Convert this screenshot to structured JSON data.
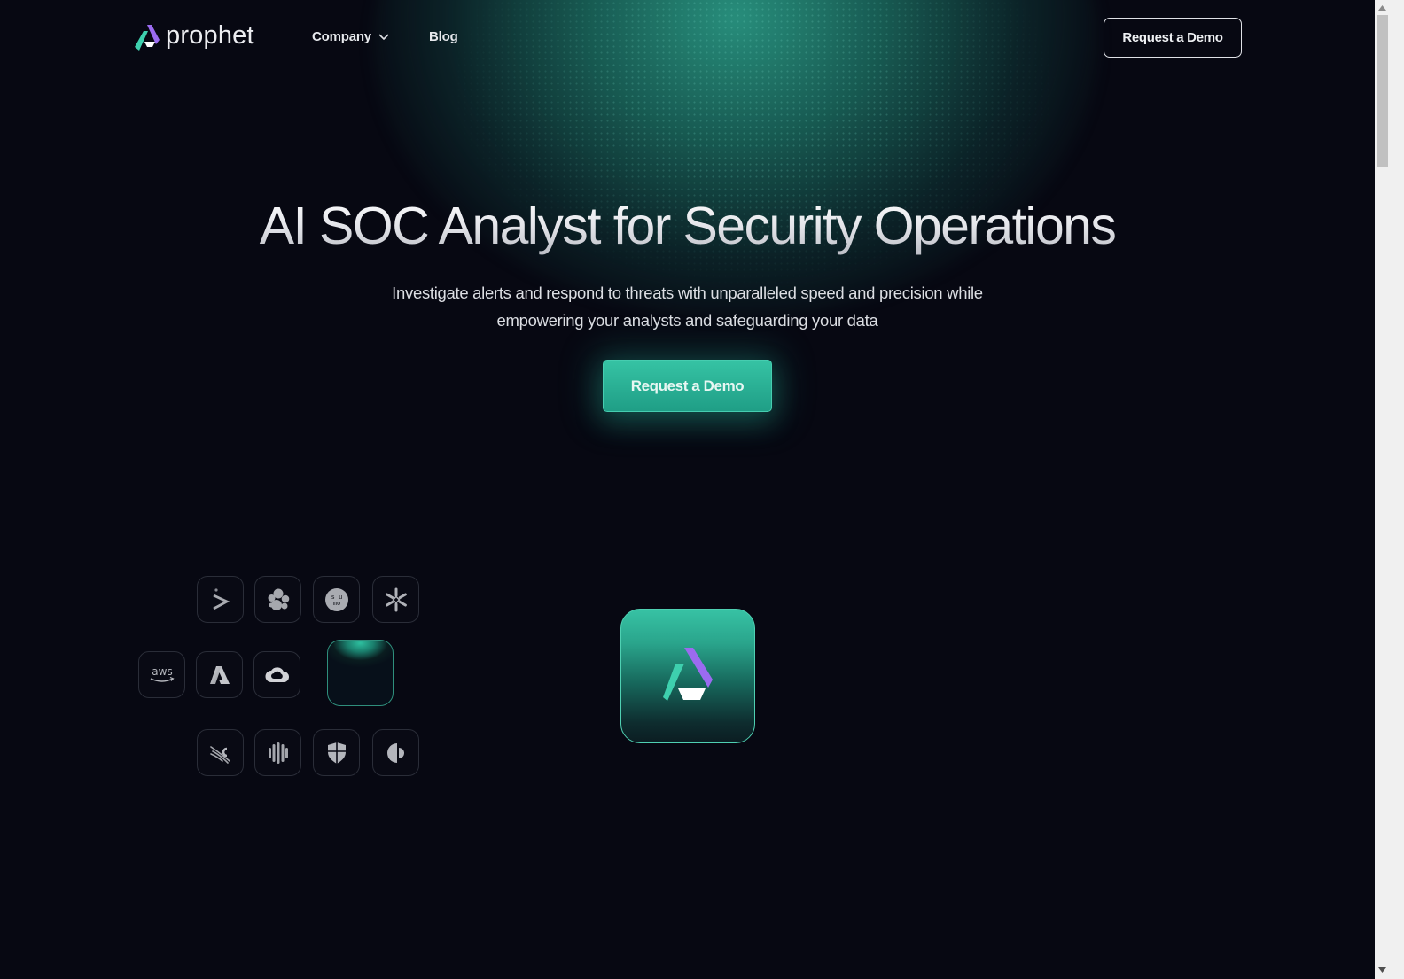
{
  "brand": {
    "name": "prophet",
    "colors": {
      "accent": "#2fb89b",
      "logo_teal": "#3ed0ae",
      "logo_purple": "#9b6bf0",
      "background": "#070812"
    }
  },
  "nav": {
    "items": [
      {
        "label": "Company",
        "has_dropdown": true,
        "icon": "chevron-down-icon"
      },
      {
        "label": "Blog",
        "has_dropdown": false
      }
    ],
    "cta_label": "Request a Demo"
  },
  "hero": {
    "title": "AI SOC Analyst for Security Operations",
    "subtitle_line1": "Investigate alerts and respond to threats with unparalleled speed and precision while",
    "subtitle_line2": "empowering your analysts and safeguarding your data",
    "cta_label": "Request a Demo"
  },
  "integrations": {
    "row1": [
      "splunk-icon",
      "elastic-icon",
      "sumo-logic-icon",
      "snowflake-icon"
    ],
    "row2": [
      "aws-icon",
      "azure-icon",
      "google-cloud-icon"
    ],
    "row3": [
      "crowdstrike-icon",
      "sentinelone-icon",
      "microsoft-defender-icon",
      "cortex-icon"
    ],
    "aws_text": "aws",
    "sumo_text_top": "s u",
    "sumo_text_bottom": "mo"
  }
}
